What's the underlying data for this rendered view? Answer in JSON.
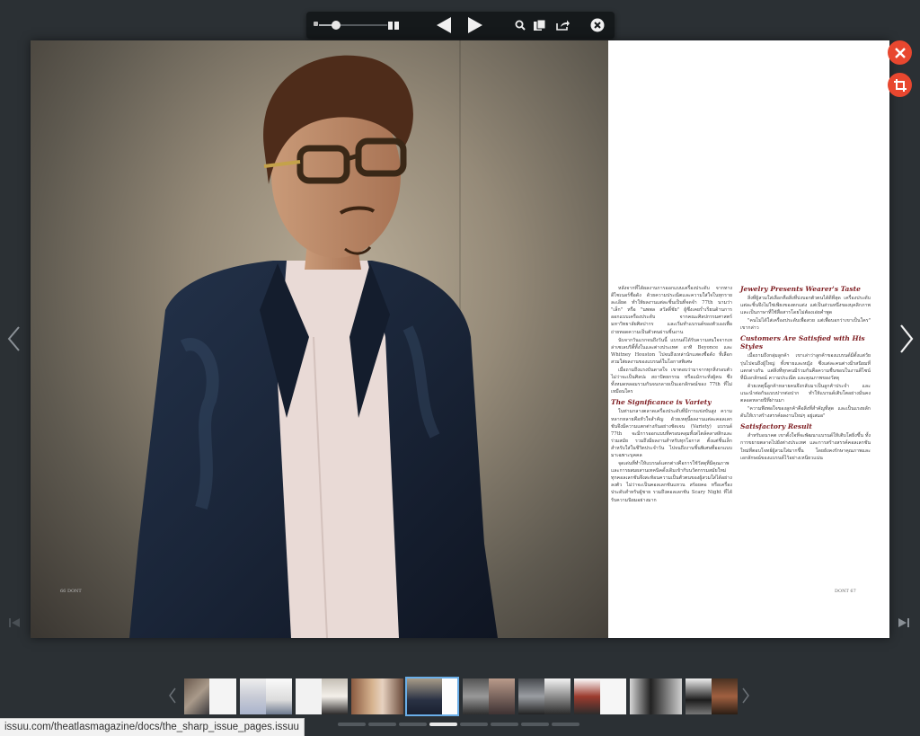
{
  "toolbar": {
    "zoom_slider": "zoom-slider",
    "icons": [
      "spread-view-icon",
      "arrow-left-icon",
      "arrow-right-icon",
      "search-icon",
      "pages-icon",
      "share-icon",
      "close-circle-icon"
    ]
  },
  "colors": {
    "background": "#2b3034",
    "toolbar": "#15191b",
    "accent": "#e8472f",
    "heading": "#7e1d21",
    "thumb_active": "#6aaee8"
  },
  "article": {
    "left_column": {
      "paragraphs": [
        "หลังจากที่ได้ผลงานการออกแบบเครื่องประดับ จากทางดีไซเนอร์ชื่อดัง ด้วยความประณีตและความใส่ใจในทุกรายละเอียด ทำให้ผลงานแต่ละชิ้นเป็นที่จดจำ 77th นามว่า \"เล็ก\" หรือ \"นพพล สวัสดิ์ชัย\" ผู้ซึ่งเคยร่ำเรียนด้านการออกแบบเครื่องประดับ จากคณะศิลปกรรมศาสตร์ มหาวิทยาลัยศิลปากร และเริ่มทำแบรนด์ของตัวเองเพื่อถ่ายทอดความเป็นตัวตนผ่านชิ้นงาน",
        "นับจากวันแรกจนถึงวันนี้ แบรนด์ได้รับความสนใจจากเหล่าเซเลบริตี้ทั้งในและต่างประเทศ อาทิ Beyonce และ Whitney Houston ไปจนถึงเหล่านักแสดงชื่อดัง ที่เลือกสวมใส่ผลงานของแบรนด์ในโอกาสพิเศษ",
        "เมื่อถามถึงแรงบันดาลใจ เขาตอบว่ามาจากทุกสิ่งรอบตัว ไม่ว่าจะเป็นศิลปะ สถาปัตยกรรม หรือแม้กระทั่งผู้คน ซึ่งทั้งหมดหลอมรวมกันจนกลายเป็นเอกลักษณ์ของ 77th ที่ไม่เหมือนใคร"
      ],
      "heading": "The Significance is Variety",
      "paragraphs2": [
        "ในท่ามกลางตลาดเครื่องประดับที่มีการแข่งขันสูง ความหลากหลายคือหัวใจสำคัญ ด้วยเหตุนี้ผลงานแต่ละคอลเลกชันจึงมีความแตกต่างกันอย่างชัดเจน (Variety) แบรนด์ 77th จะมีการออกแบบที่ครอบคลุมทั้งสไตล์คลาสสิกและร่วมสมัย รวมถึงมีผลงานสำหรับทุกโอกาส ตั้งแต่ชิ้นเล็กสำหรับใส่ในชีวิตประจำวัน ไปจนถึงงานชิ้นพิเศษที่ออกแบบมาเฉพาะบุคคล",
        "จุดเด่นที่ทำให้แบรนด์แตกต่างคือการใช้วัสดุที่มีคุณภาพ และการผสมผสานเทคนิคดั้งเดิมเข้ากับนวัตกรรมสมัยใหม่ ทุกคอลเลกชันจึงสะท้อนความเป็นตัวตนของผู้สวมใส่ได้อย่างลงตัว ไม่ว่าจะเป็นคอลเลกชันแหวน สร้อยคอ หรือเครื่องประดับสำหรับผู้ชาย รวมถึงคอลเลกชัน Scary Night ที่ได้รับความนิยมอย่างมาก"
      ]
    },
    "right_column": {
      "sections": [
        {
          "heading": "Jewelry Presents Wearer's Taste",
          "paragraphs": [
            "สิ่งที่ผู้สวมใส่เลือกคือสิ่งที่บ่งบอกตัวตนได้ดีที่สุด เครื่องประดับแต่ละชิ้นจึงไม่ใช่เพียงของตกแต่ง แต่เป็นส่วนหนึ่งของบุคลิกภาพ และเป็นภาษาที่ใช้สื่อสารโดยไม่ต้องเอ่ยคำพูด",
            "\"คนไม่ได้ใส่เครื่องประดับเพื่อสวย แต่เพื่อบอกว่าเขาเป็นใคร\" เขากล่าว"
          ]
        },
        {
          "heading": "Customers Are Satisfied with His Styles",
          "paragraphs": [
            "เมื่อถามถึงกลุ่มลูกค้า เขาเล่าว่าลูกค้าของแบรนด์มีตั้งแต่วัยรุ่นไปจนถึงผู้ใหญ่ ทั้งชายและหญิง ซึ่งแต่ละคนต่างมีรสนิยมที่แตกต่างกัน แต่สิ่งที่ทุกคนมีร่วมกันคือความชื่นชอบในงานดีไซน์ที่มีเอกลักษณ์ ความประณีต และคุณภาพของวัสดุ",
            "ด้วยเหตุนี้ลูกค้าหลายคนจึงกลับมาเป็นลูกค้าประจำ และแนะนำต่อกันแบบปากต่อปาก ทำให้แบรนด์เติบโตอย่างมั่นคงตลอดหลายปีที่ผ่านมา",
            "\"ความพึงพอใจของลูกค้าคือสิ่งที่สำคัญที่สุด และเป็นแรงผลักดันให้เราสร้างสรรค์ผลงานใหม่ๆ อยู่เสมอ\""
          ]
        },
        {
          "heading": "Satisfactory Result",
          "paragraphs": [
            "สำหรับอนาคต เขาตั้งใจที่จะพัฒนาแบรนด์ให้เติบโตยิ่งขึ้น ทั้งการขยายตลาดไปยังต่างประเทศ และการสร้างสรรค์คอลเลกชันใหม่ที่ตอบโจทย์ผู้สวมใส่มากขึ้น โดยยังคงรักษาคุณภาพและเอกลักษณ์ของแบรนด์ไว้อย่างเหนียวแน่น"
          ]
        }
      ]
    },
    "folio_left": "66 DONT",
    "folio_right": "DONT 67"
  },
  "thumbnail_strip": {
    "pages": [
      "pages 1",
      "pages 2-3",
      "pages 4-5",
      "pages 6-7",
      "pages 8-9",
      "pages 10-11",
      "pages 12-13",
      "pages 14-15",
      "pages 16-17",
      "pages 18-19"
    ],
    "active_index": 4
  },
  "pager": {
    "count": 8,
    "active_index": 3
  },
  "status": {
    "url": "issuu.com/theatlasmagazine/docs/the_sharp_issue_pages.issuu"
  }
}
